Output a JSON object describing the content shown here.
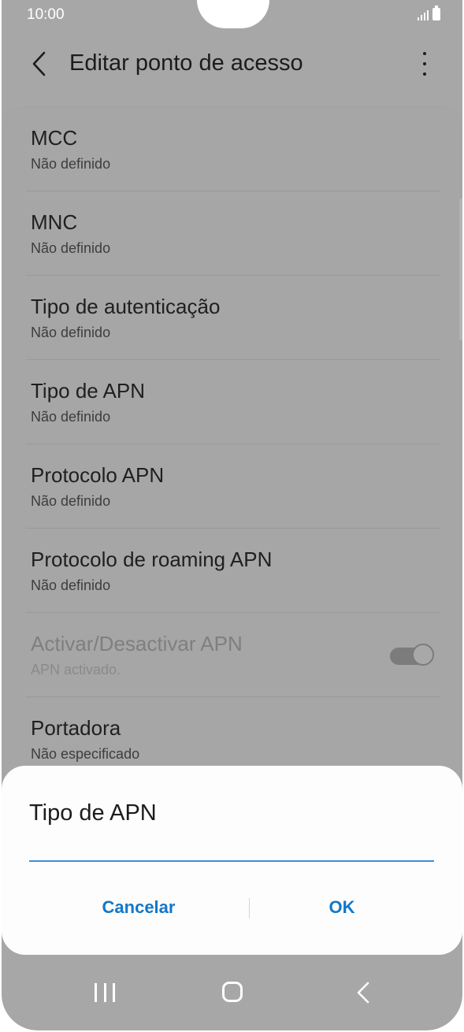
{
  "status_bar": {
    "time": "10:00"
  },
  "app_bar": {
    "title": "Editar ponto de acesso"
  },
  "settings": {
    "items": [
      {
        "title": "MCC",
        "subtitle": "Não definido"
      },
      {
        "title": "MNC",
        "subtitle": "Não definido"
      },
      {
        "title": "Tipo de autenticação",
        "subtitle": "Não definido"
      },
      {
        "title": "Tipo de APN",
        "subtitle": "Não definido"
      },
      {
        "title": "Protocolo APN",
        "subtitle": "Não definido"
      },
      {
        "title": "Protocolo de roaming APN",
        "subtitle": "Não definido"
      },
      {
        "title": "Activar/Desactivar APN",
        "subtitle": "APN activado.",
        "toggle_on": true,
        "disabled": true
      },
      {
        "title": "Portadora",
        "subtitle": "Não especificado"
      }
    ]
  },
  "dialog": {
    "title": "Tipo de APN",
    "input_value": "",
    "cancel_label": "Cancelar",
    "ok_label": "OK"
  },
  "colors": {
    "accent": "#1177c9",
    "input_underline": "#3c8ed8",
    "scrim_background": "#a7a7a7",
    "dialog_background": "#fdfdfd"
  }
}
